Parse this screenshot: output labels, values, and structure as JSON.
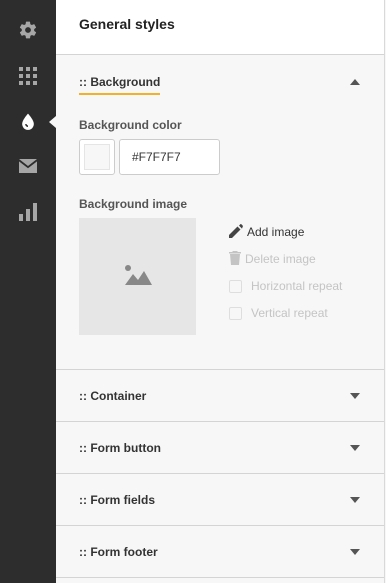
{
  "sidebar": {
    "items": [
      {
        "icon": "gear-icon"
      },
      {
        "icon": "grid-icon"
      },
      {
        "icon": "drop-icon",
        "active": true
      },
      {
        "icon": "envelope-icon"
      },
      {
        "icon": "bar-chart-icon"
      }
    ]
  },
  "panel": {
    "title": "General styles"
  },
  "background": {
    "label": ":: Background",
    "color_label": "Background color",
    "color_value": "#F7F7F7",
    "image_label": "Background image",
    "add_image": "Add image",
    "delete_image": "Delete image",
    "horizontal_repeat": "Horizontal repeat",
    "vertical_repeat": "Vertical repeat"
  },
  "sections": {
    "container": ":: Container",
    "form_button": ":: Form button",
    "form_fields": ":: Form fields",
    "form_footer": ":: Form footer"
  },
  "colors": {
    "sidebar_bg": "#2d2d2d",
    "accent": "#f1b12a",
    "icon": "#a6a6a6"
  }
}
